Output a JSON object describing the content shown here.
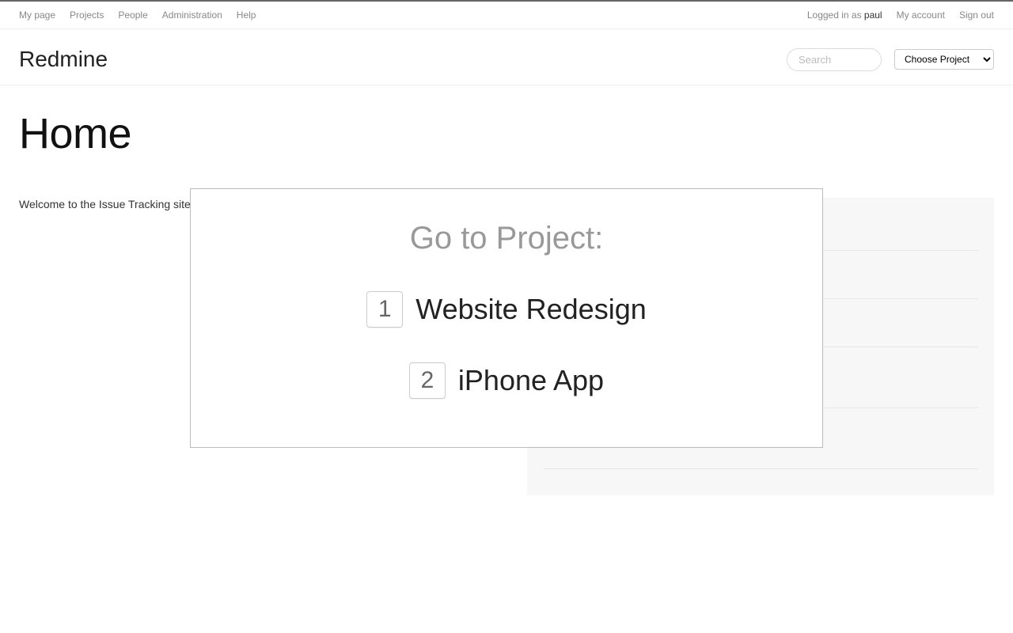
{
  "topnav": {
    "left": {
      "my_page": "My page",
      "projects": "Projects",
      "people": "People",
      "administration": "Administration",
      "help": "Help"
    },
    "right": {
      "logged_in_prefix": "Logged in as ",
      "username": "paul",
      "my_account": "My account",
      "sign_out": "Sign out"
    }
  },
  "header": {
    "app_title": "Redmine",
    "search_placeholder": "Search",
    "project_select_label": "Choose Project"
  },
  "page": {
    "title": "Home",
    "welcome": "Welcome to the Issue Tracking site"
  },
  "overlay": {
    "title": "Go to Project:",
    "items": [
      {
        "key": "1",
        "label": "Website Redesign"
      },
      {
        "key": "2",
        "label": "iPhone App"
      }
    ]
  }
}
